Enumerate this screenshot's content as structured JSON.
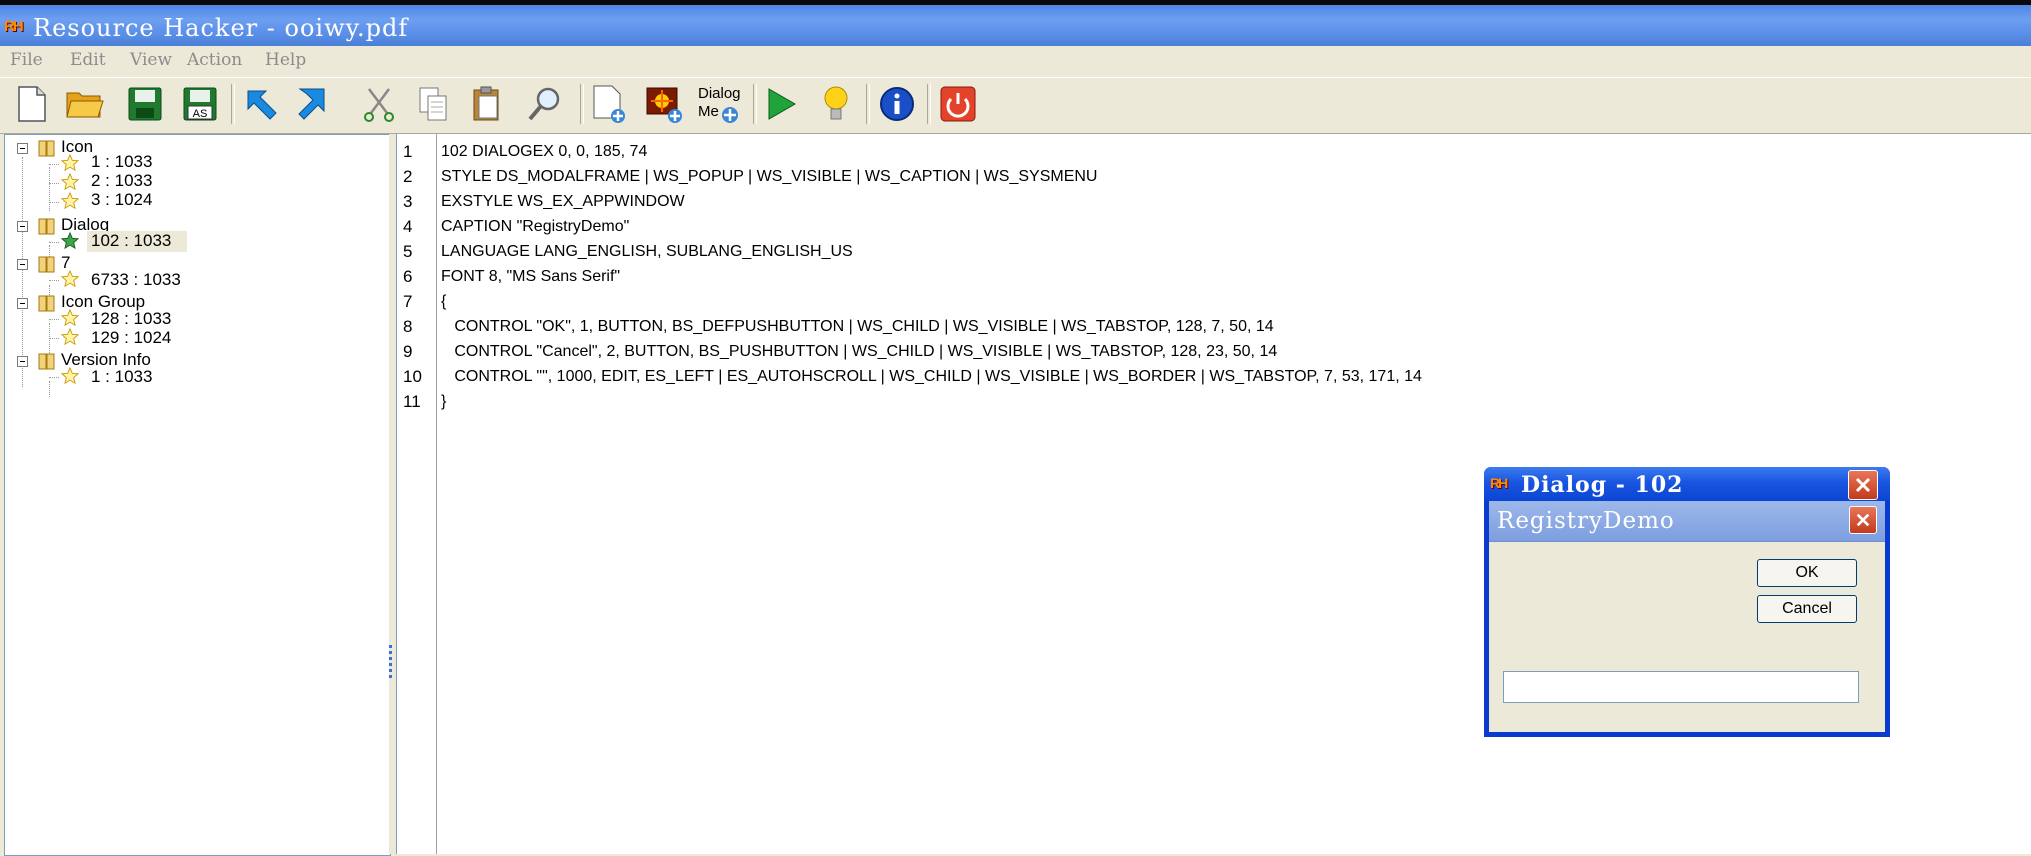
{
  "window": {
    "title": "Resource Hacker  -  ooiwy.pdf",
    "logo_text": "RH"
  },
  "menu": {
    "items": [
      "File",
      "Edit",
      "View",
      "Action",
      "Help"
    ]
  },
  "toolbar": {
    "dialog_menu_label_1": "Dialog",
    "dialog_menu_label_2": "Me",
    "icons": [
      "new-file-icon",
      "open-folder-icon",
      "save-icon",
      "save-as-icon",
      "back-arrow-icon",
      "forward-arrow-icon",
      "cut-icon",
      "copy-icon",
      "paste-icon",
      "find-icon",
      "add-resource-icon",
      "add-image-icon",
      "dialog-merger-icon",
      "run-script-icon",
      "hint-icon",
      "about-icon",
      "exit-icon"
    ],
    "save_as_label": "AS"
  },
  "tree": {
    "nodes": [
      {
        "label": "Icon",
        "children": [
          "1 : 1033",
          "2 : 1033",
          "3 : 1024"
        ]
      },
      {
        "label": "Dialog",
        "children": [
          "102 : 1033"
        ]
      },
      {
        "label": "7",
        "children": [
          "6733 : 1033"
        ]
      },
      {
        "label": "Icon Group",
        "children": [
          "128 : 1033",
          "129 : 1024"
        ]
      },
      {
        "label": "Version Info",
        "children": [
          "1 : 1033"
        ]
      }
    ],
    "selected": "102 : 1033"
  },
  "editor": {
    "line_numbers": [
      "1",
      "2",
      "3",
      "4",
      "5",
      "6",
      "7",
      "8",
      "9",
      "10",
      "11"
    ],
    "lines": [
      "102 DIALOGEX 0, 0, 185, 74",
      "STYLE DS_MODALFRAME | WS_POPUP | WS_VISIBLE | WS_CAPTION | WS_SYSMENU",
      "EXSTYLE WS_EX_APPWINDOW",
      "CAPTION \"RegistryDemo\"",
      "LANGUAGE LANG_ENGLISH, SUBLANG_ENGLISH_US",
      "FONT 8, \"MS Sans Serif\"",
      "{",
      "   CONTROL \"OK\", 1, BUTTON, BS_DEFPUSHBUTTON | WS_CHILD | WS_VISIBLE | WS_TABSTOP, 128, 7, 50, 14",
      "   CONTROL \"Cancel\", 2, BUTTON, BS_PUSHBUTTON | WS_CHILD | WS_VISIBLE | WS_TABSTOP, 128, 23, 50, 14",
      "   CONTROL \"\", 1000, EDIT, ES_LEFT | ES_AUTOHSCROLL | WS_CHILD | WS_VISIBLE | WS_BORDER | WS_TABSTOP, 7, 53, 171, 14",
      "}"
    ]
  },
  "preview_dialog": {
    "title": "Dialog  -   102",
    "logo_text": "RH",
    "caption": "RegistryDemo",
    "ok_label": "OK",
    "cancel_label": "Cancel",
    "edit_value": ""
  }
}
